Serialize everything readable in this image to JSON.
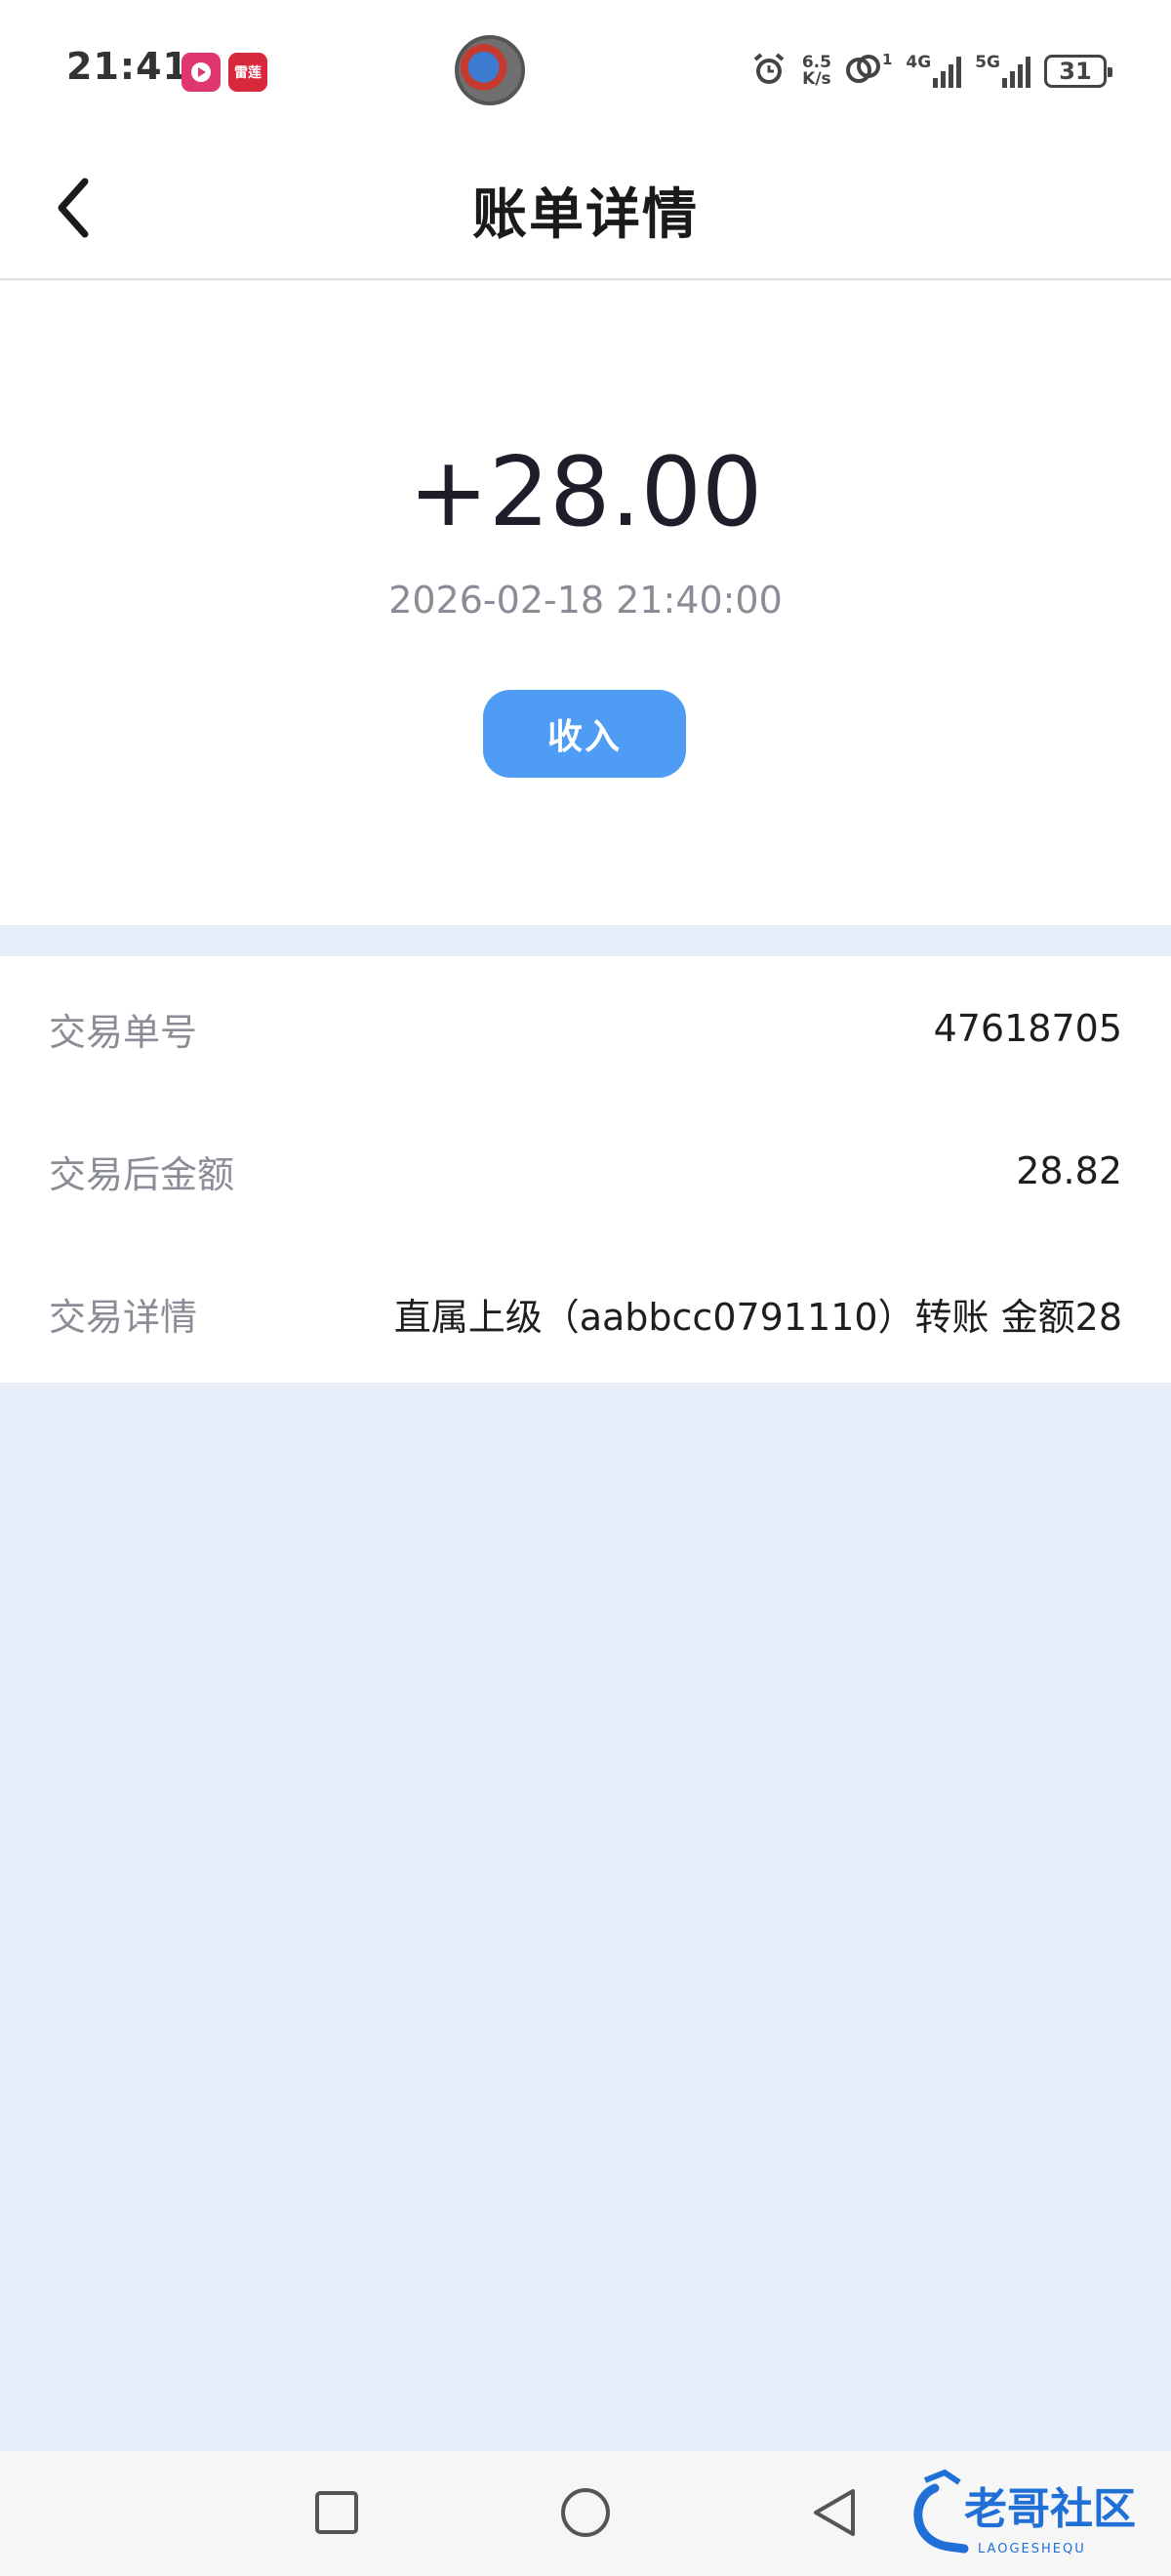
{
  "status_bar": {
    "time": "21:41",
    "app_icon_2_text": "雷莲",
    "net_speed_value": "6.5",
    "net_speed_unit": "K/s",
    "sim1_type": "4G",
    "sim2_type": "5G",
    "link_badge": "1",
    "battery_level": "31"
  },
  "nav": {
    "title": "账单详情",
    "back_icon": "chevron-left-icon"
  },
  "summary": {
    "amount": "+28.00",
    "datetime": "2026-02-18 21:40:00",
    "type_label": "收入",
    "type_color": "#4f9cf5"
  },
  "details": {
    "rows": [
      {
        "label": "交易单号",
        "value": "47618705"
      },
      {
        "label": "交易后金额",
        "value": "28.82"
      },
      {
        "label": "交易详情",
        "value": "直属上级（aabbcc0791110）转账 金额28"
      }
    ]
  },
  "system_nav": {
    "recent_icon": "square-icon",
    "home_icon": "circle-icon",
    "back_icon": "triangle-back-icon"
  },
  "watermark": {
    "text": "老哥社区",
    "subtext": "LAOGESHEQU"
  },
  "colors": {
    "page_background": "#e6edf8",
    "accent": "#4f9cf5"
  }
}
